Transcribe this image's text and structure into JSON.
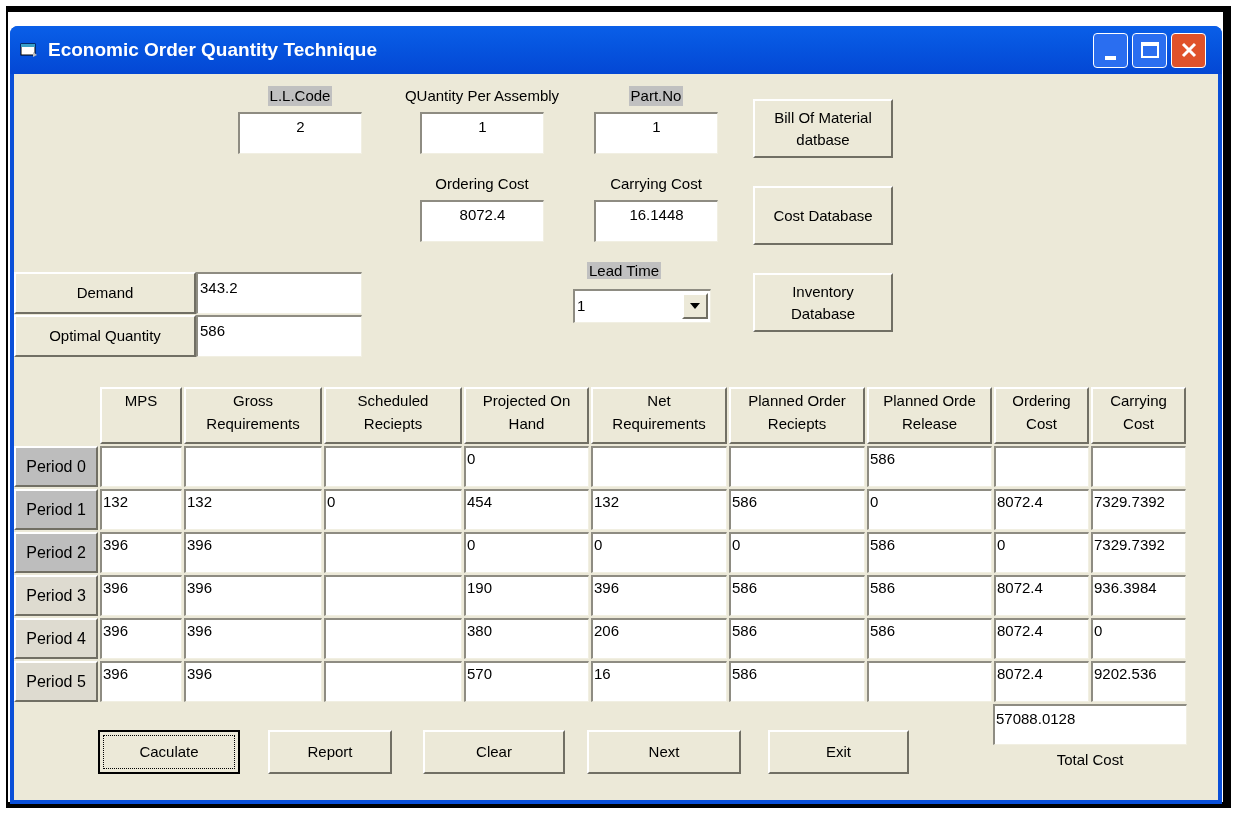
{
  "window": {
    "title": "Economic Order Quantity Technique"
  },
  "ll_code": {
    "label": "L.L.Code",
    "highlighted": true,
    "value": "2"
  },
  "quantity_per_assembly": {
    "label": "QUantity Per Assembly",
    "highlighted": false,
    "value": "1"
  },
  "part_no": {
    "label": "Part.No",
    "highlighted": true,
    "value": "1"
  },
  "ordering_cost": {
    "label": "Ordering Cost",
    "highlighted": false,
    "value": "8072.4"
  },
  "carrying_cost": {
    "label": "Carrying Cost",
    "highlighted": false,
    "value": "16.1448"
  },
  "lead_time": {
    "label": "Lead Time",
    "highlighted": true,
    "value": "1"
  },
  "database_buttons": [
    {
      "lines": [
        "Bill Of Material",
        "datbase"
      ]
    },
    {
      "lines": [
        "Cost Database"
      ]
    },
    {
      "lines": [
        "Inventory",
        "Database"
      ]
    }
  ],
  "demand": {
    "button": "Demand",
    "value": "343.2"
  },
  "optimal_quantity": {
    "button": "Optimal Quantity",
    "value": "586"
  },
  "table": {
    "columns": [
      "MPS",
      "Gross\nRequirements",
      "Scheduled\nReciepts",
      "Projected On\nHand",
      "Net\nRequirements",
      "Planned Order\nReciepts",
      "Planned Orde\nRelease",
      "Ordering\nCost",
      "Carrying\nCost"
    ],
    "rows": [
      {
        "label": "Period 0",
        "selected": true,
        "cells": [
          "",
          "",
          "",
          "0",
          "",
          "",
          "586",
          "",
          ""
        ]
      },
      {
        "label": "Period 1",
        "selected": true,
        "cells": [
          "132",
          "132",
          "0",
          "454",
          "132",
          "586",
          "0",
          "8072.4",
          "7329.7392"
        ]
      },
      {
        "label": "Period 2",
        "selected": true,
        "cells": [
          "396",
          "396",
          "",
          "0",
          "0",
          "0",
          "586",
          "0",
          "7329.7392"
        ]
      },
      {
        "label": "Period 3",
        "selected": false,
        "cells": [
          "396",
          "396",
          "",
          "190",
          "396",
          "586",
          "586",
          "8072.4",
          "936.3984"
        ]
      },
      {
        "label": "Period 4",
        "selected": false,
        "cells": [
          "396",
          "396",
          "",
          "380",
          "206",
          "586",
          "586",
          "8072.4",
          "0"
        ]
      },
      {
        "label": "Period 5",
        "selected": false,
        "cells": [
          "396",
          "396",
          "",
          "570",
          "16",
          "586",
          "",
          "8072.4",
          "9202.536"
        ]
      }
    ]
  },
  "total_cost": {
    "value": "57088.0128",
    "label": "Total Cost"
  },
  "buttons": [
    {
      "label": "Caculate",
      "focused": true
    },
    {
      "label": "Report",
      "focused": false
    },
    {
      "label": "Clear",
      "focused": false
    },
    {
      "label": "Next",
      "focused": false
    },
    {
      "label": "Exit",
      "focused": false
    }
  ]
}
